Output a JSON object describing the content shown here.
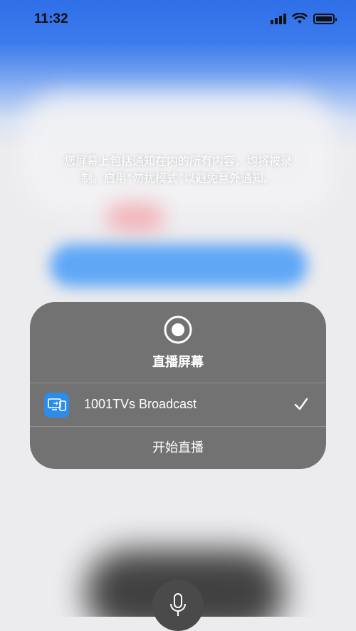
{
  "status_bar": {
    "time": "11:32"
  },
  "background": {
    "notice_line1": "您屏幕上包括通知在内的所有内容，均将被录",
    "notice_line2": "制。启用“勿扰模式”以避免意外通知。"
  },
  "sheet": {
    "title": "直播屏幕",
    "option": {
      "label": "1001TVs Broadcast",
      "selected": true,
      "icon": "screen-mirror-icon"
    },
    "start_label": "开始直播"
  },
  "colors": {
    "sheet_bg": "#6c6c6c",
    "app_icon": "#2c8de8",
    "accent_blue": "#2f6fe8"
  },
  "icons": [
    "record-icon",
    "screen-mirror-icon",
    "checkmark-icon",
    "microphone-icon",
    "signal-icon",
    "wifi-icon",
    "battery-icon"
  ]
}
